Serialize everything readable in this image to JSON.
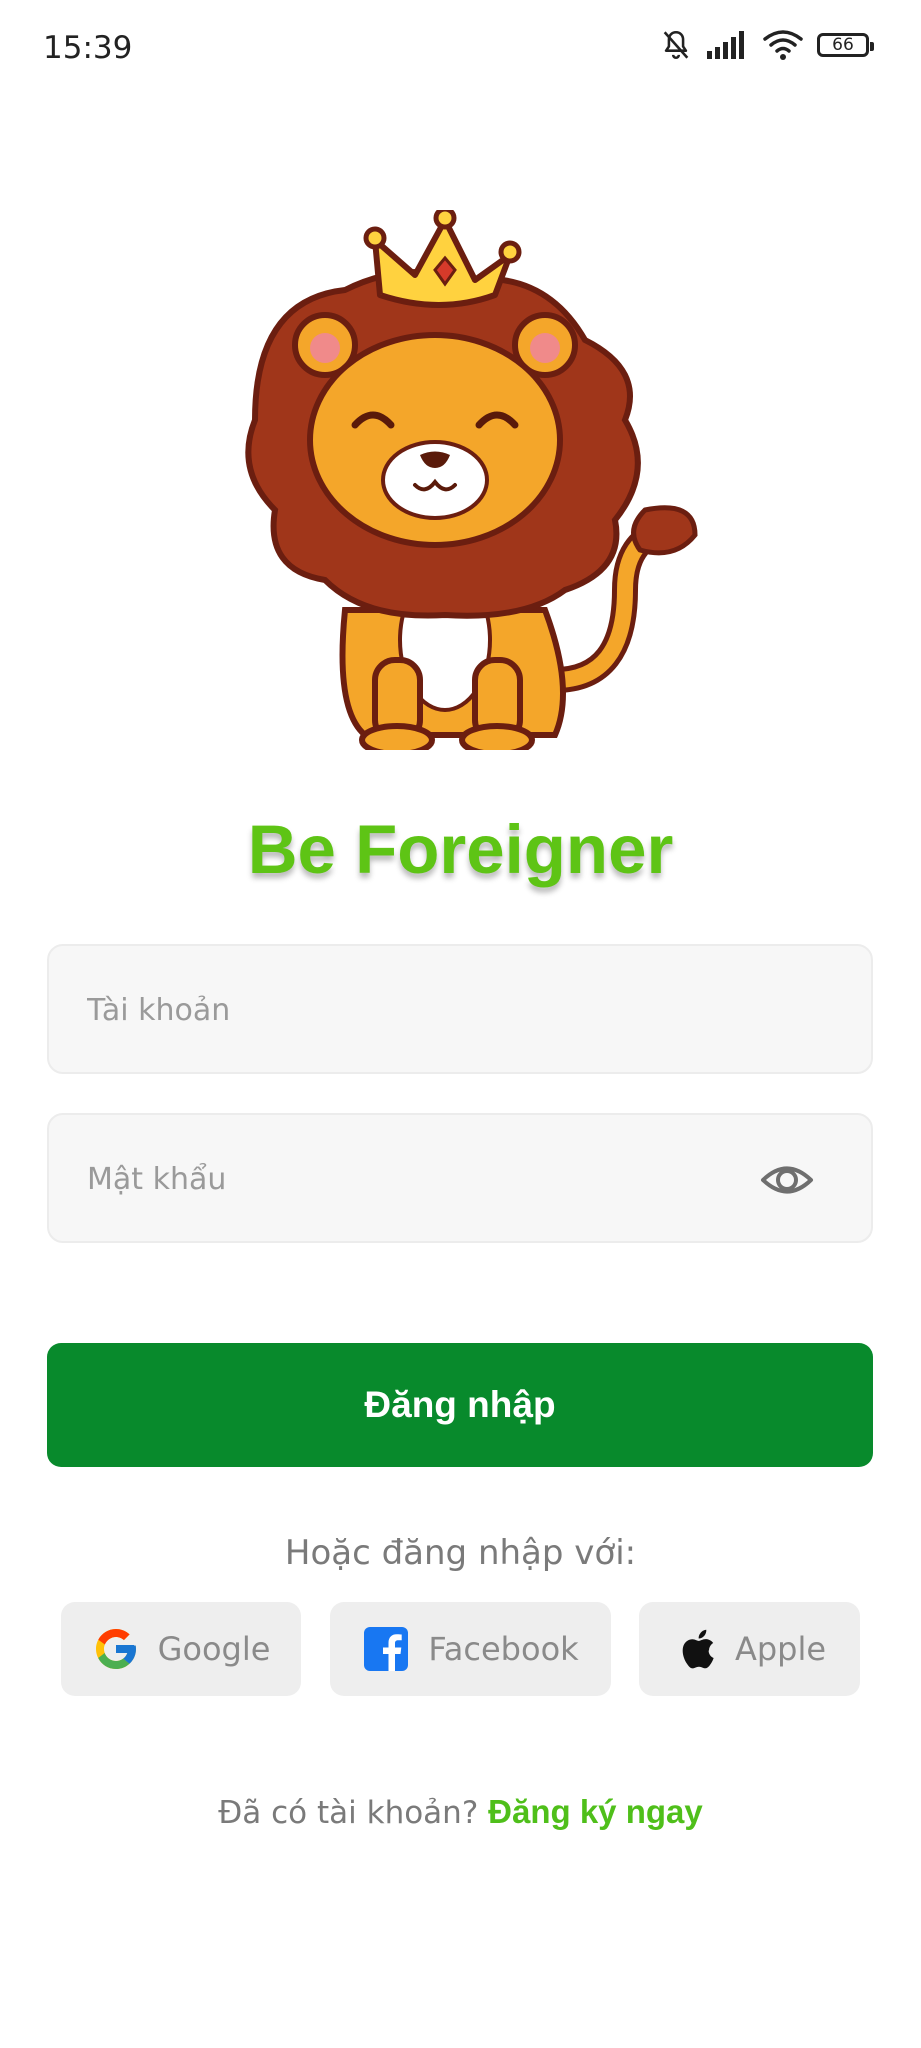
{
  "status_bar": {
    "time": "15:39",
    "battery_level": "66",
    "icons": [
      "bell-off-icon",
      "signal-icon",
      "wifi-icon",
      "battery-icon"
    ]
  },
  "brand": {
    "title": "Be Foreigner",
    "title_color": "#5ec415",
    "mascot": "lion-king-mascot"
  },
  "form": {
    "username_placeholder": "Tài khoản",
    "password_placeholder": "Mật khẩu",
    "login_label": "Đăng nhập",
    "login_color": "#088a2c"
  },
  "social": {
    "or_text": "Hoặc đăng nhập với:",
    "google_label": "Google",
    "facebook_label": "Facebook",
    "apple_label": "Apple"
  },
  "footer": {
    "question": "Đã có tài khoản?",
    "register_label": "Đăng ký ngay",
    "link_color": "#4fbf1a"
  }
}
